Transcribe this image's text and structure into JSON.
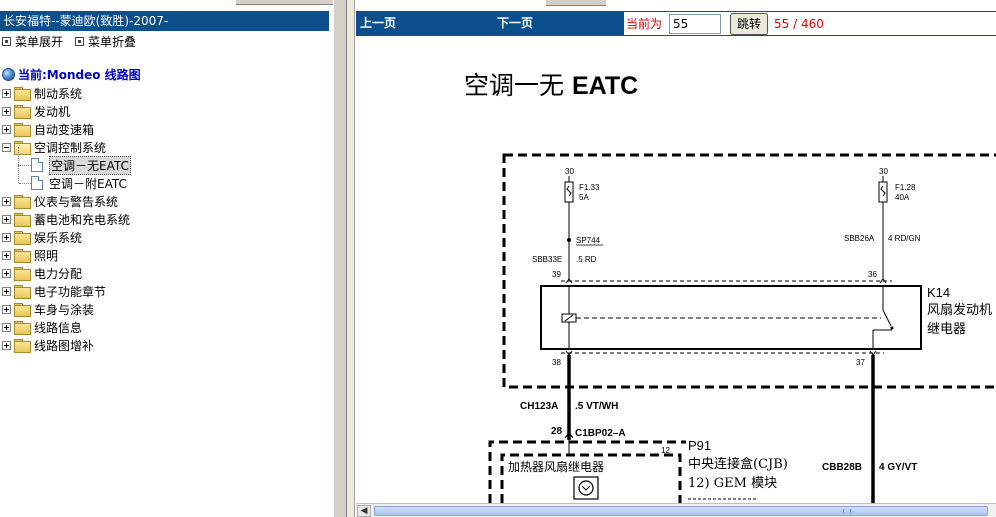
{
  "sidebar": {
    "title": "长安福特--蒙迪欧(致胜)-2007-",
    "expand_all": "菜单展开",
    "collapse_all": "菜单折叠",
    "current": "当前:Mondeo 线路图",
    "items": [
      {
        "label": "制动系统"
      },
      {
        "label": "发动机"
      },
      {
        "label": "自动变速箱"
      },
      {
        "label": "空调控制系统",
        "children": [
          {
            "label": "空调－无EATC"
          },
          {
            "label": "空调－附EATC"
          }
        ]
      },
      {
        "label": "仪表与警告系统"
      },
      {
        "label": "蓄电池和充电系统"
      },
      {
        "label": "娱乐系统"
      },
      {
        "label": "照明"
      },
      {
        "label": "电力分配"
      },
      {
        "label": "电子功能章节"
      },
      {
        "label": "车身与涂装"
      },
      {
        "label": "线路信息"
      },
      {
        "label": "线路图增补"
      }
    ]
  },
  "toolbar": {
    "prev": "上一页",
    "next": "下一页",
    "current_label": "当前为",
    "page_value": "55",
    "jump_label": "跳转",
    "page_count": "55 / 460"
  },
  "diagram": {
    "title_cn": "空调一无",
    "title_en": "EATC",
    "labels": {
      "left_30": "30",
      "right_30": "30",
      "fuse_left_name": "F1.33",
      "fuse_left_amp": "5A",
      "fuse_right_name": "F1.28",
      "fuse_right_amp": "40A",
      "splice": "SP744",
      "left_wire_code": "SBB33E",
      "left_wire_spec": ".5 RD",
      "right_wire_code": "SBB26A",
      "right_wire_spec": "4 RD/GN",
      "pin_39": "39",
      "pin_36": "36",
      "pin_38": "38",
      "pin_37": "37",
      "relay_id": "K14",
      "relay_name_1": "风扇发动机",
      "relay_name_2": "继电器",
      "wire_ch_code": "CH123A",
      "wire_ch_spec": ".5 VT/WH",
      "pin_28": "28",
      "connector": "C1BP02–A",
      "module_pin_12": "12",
      "heater_relay": "加热器风扇继电器",
      "module_id": "P91",
      "module_name_1": "中央连接盒(CJB)",
      "module_name_2": "12) GEM 模块",
      "wire_cbb_code": "CBB28B",
      "wire_cbb_spec": "4 GY/VT"
    }
  }
}
